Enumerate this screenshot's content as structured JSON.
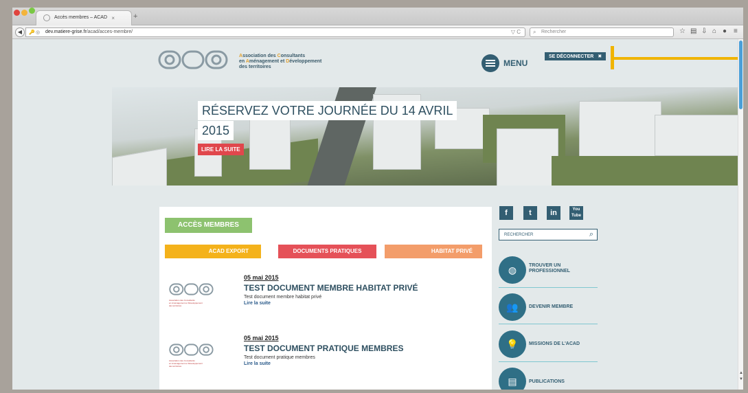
{
  "browser": {
    "tab_title": "Accès membres – ACAD",
    "tab_close": "×",
    "new_tab": "+",
    "url_host": "dev.matiere-grise.fr",
    "url_path": "/acad/acces-membre/",
    "url_reload": "▽ C",
    "search_placeholder": "Rechercher",
    "toolbar_icons": [
      "star-icon",
      "bookmarks-icon",
      "download-icon",
      "home-icon",
      "chat-icon",
      "hamburger-icon"
    ]
  },
  "header": {
    "org_line1_a": "A",
    "org_line1_b": "ssociation des ",
    "org_line1_c": "C",
    "org_line1_d": "onsultants",
    "org_line2_a": "en ",
    "org_line2_b": "A",
    "org_line2_c": "ménagement et ",
    "org_line2_d": "D",
    "org_line2_e": "éveloppement",
    "org_line3": "des territoires",
    "menu_label": "MENU",
    "logout_label": "SE DÉCONNECTER",
    "logout_icon": "✖"
  },
  "hero": {
    "title_line1": "RÉSERVEZ VOTRE JOURNÉE DU 14 AVRIL",
    "title_line2": "2015",
    "read_more": "LIRE LA SUITE"
  },
  "main": {
    "section_label": "ACCÈS MEMBRES",
    "categories": [
      "ACAD EXPORT",
      "DOCUMENTS PRATIQUES",
      "HABITAT PRIVÉ"
    ],
    "items": [
      {
        "date": "05 mai 2015",
        "title": "TEST DOCUMENT MEMBRE HABITAT PRIVÉ",
        "desc": "Test document membre habitat privé",
        "more": "Lire la suite"
      },
      {
        "date": "05 mai 2015",
        "title": "TEST DOCUMENT PRATIQUE MEMBRES",
        "desc": "Test document pratique membres",
        "more": "Lire la suite"
      }
    ]
  },
  "sidebar": {
    "social": [
      "f",
      "t",
      "in",
      "You Tube"
    ],
    "search_placeholder": "RECHERCHER",
    "links": [
      {
        "line1": "TROUVER UN",
        "line2": "PROFESSIONNEL"
      },
      {
        "line1": "DEVENIR MEMBRE",
        "line2": ""
      },
      {
        "line1": "MISSIONS DE L'ACAD",
        "line2": ""
      },
      {
        "line1": "PUBLICATIONS",
        "line2": ""
      }
    ]
  },
  "colors": {
    "brand": "#335e72",
    "green": "#8dc26f",
    "yellow": "#f4b21b",
    "red": "#e55158",
    "orange": "#f39d6a",
    "annotation": "#f0b400"
  }
}
